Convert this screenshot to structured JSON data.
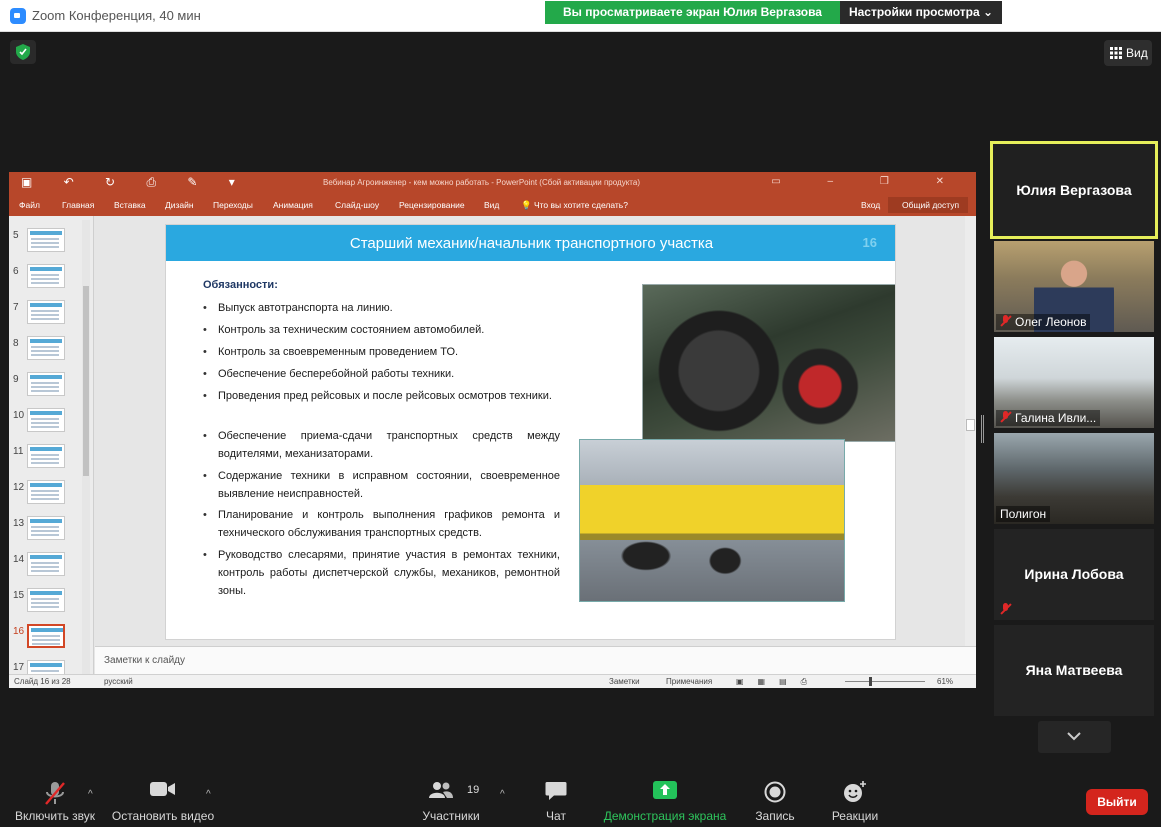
{
  "window": {
    "title": "Zoom Конференция, 40 мин"
  },
  "share_banner": {
    "text": "Вы просматриваете экран Юлия Вергазова",
    "view_settings": "Настройки просмотра"
  },
  "view_button": "Вид",
  "ppt": {
    "doc_title": "Вебинар Агроинженер - кем можно работать - PowerPoint (Сбой активации продукта)",
    "tabs": [
      "Файл",
      "Главная",
      "Вставка",
      "Дизайн",
      "Переходы",
      "Анимация",
      "Слайд-шоу",
      "Рецензирование",
      "Вид",
      "Что вы хотите сделать?"
    ],
    "signin": "Вход",
    "share": "Общий доступ",
    "thumbs": [
      "5",
      "6",
      "7",
      "8",
      "9",
      "10",
      "11",
      "12",
      "13",
      "14",
      "15",
      "16",
      "17"
    ],
    "active_thumb": "16",
    "slide": {
      "title": "Старший механик/начальник транспортного участка",
      "number": "16",
      "duties_label": "Обязанности:",
      "duties": [
        "Выпуск автотранспорта на линию.",
        "Контроль за техническим состоянием автомобилей.",
        "Контроль за своевременным проведением ТО.",
        "Обеспечение бесперебойной работы техники.",
        "Проведения пред рейсовых и после рейсовых осмотров техники.",
        "Обеспечение приема-сдачи транспортных средств между водителями, механизаторами.",
        "Содержание техники в исправном состоянии, своевременное выявление неисправностей.",
        "Планирование и контроль выполнения графиков ремонта и технического обслуживания транспортных средств.",
        "Руководство слесарями, принятие участия в ремонтах техники, контроль работы диспетчерской службы, механиков, ремонтной зоны."
      ]
    },
    "notes_placeholder": "Заметки к слайду",
    "status": {
      "slide_info": "Слайд 16 из 28",
      "language": "русский",
      "notes": "Заметки",
      "comments": "Примечания",
      "zoom": "61%"
    }
  },
  "participants": [
    {
      "name": "Юлия Вергазова",
      "video": false,
      "muted": false,
      "active": true
    },
    {
      "name": "Олег Леонов",
      "video": true,
      "muted": true
    },
    {
      "name": "Галина Ивли...",
      "video": true,
      "muted": true
    },
    {
      "name": "Полигон",
      "video": true,
      "muted": false
    },
    {
      "name": "Ирина Лобова",
      "video": false,
      "muted": true
    },
    {
      "name": "Яна Матвеева",
      "video": false,
      "muted": false
    }
  ],
  "toolbar": {
    "unmute": "Включить звук",
    "stop_video": "Остановить видео",
    "participants": "Участники",
    "participants_count": "19",
    "chat": "Чат",
    "share_screen": "Демонстрация экрана",
    "record": "Запись",
    "reactions": "Реакции",
    "leave": "Выйти"
  },
  "colors": {
    "ppt_accent": "#b7472a",
    "slide_header": "#2aa8e0",
    "banner_green": "#23a94a",
    "active_speaker": "#e6ef5a",
    "leave_red": "#d4251d"
  }
}
